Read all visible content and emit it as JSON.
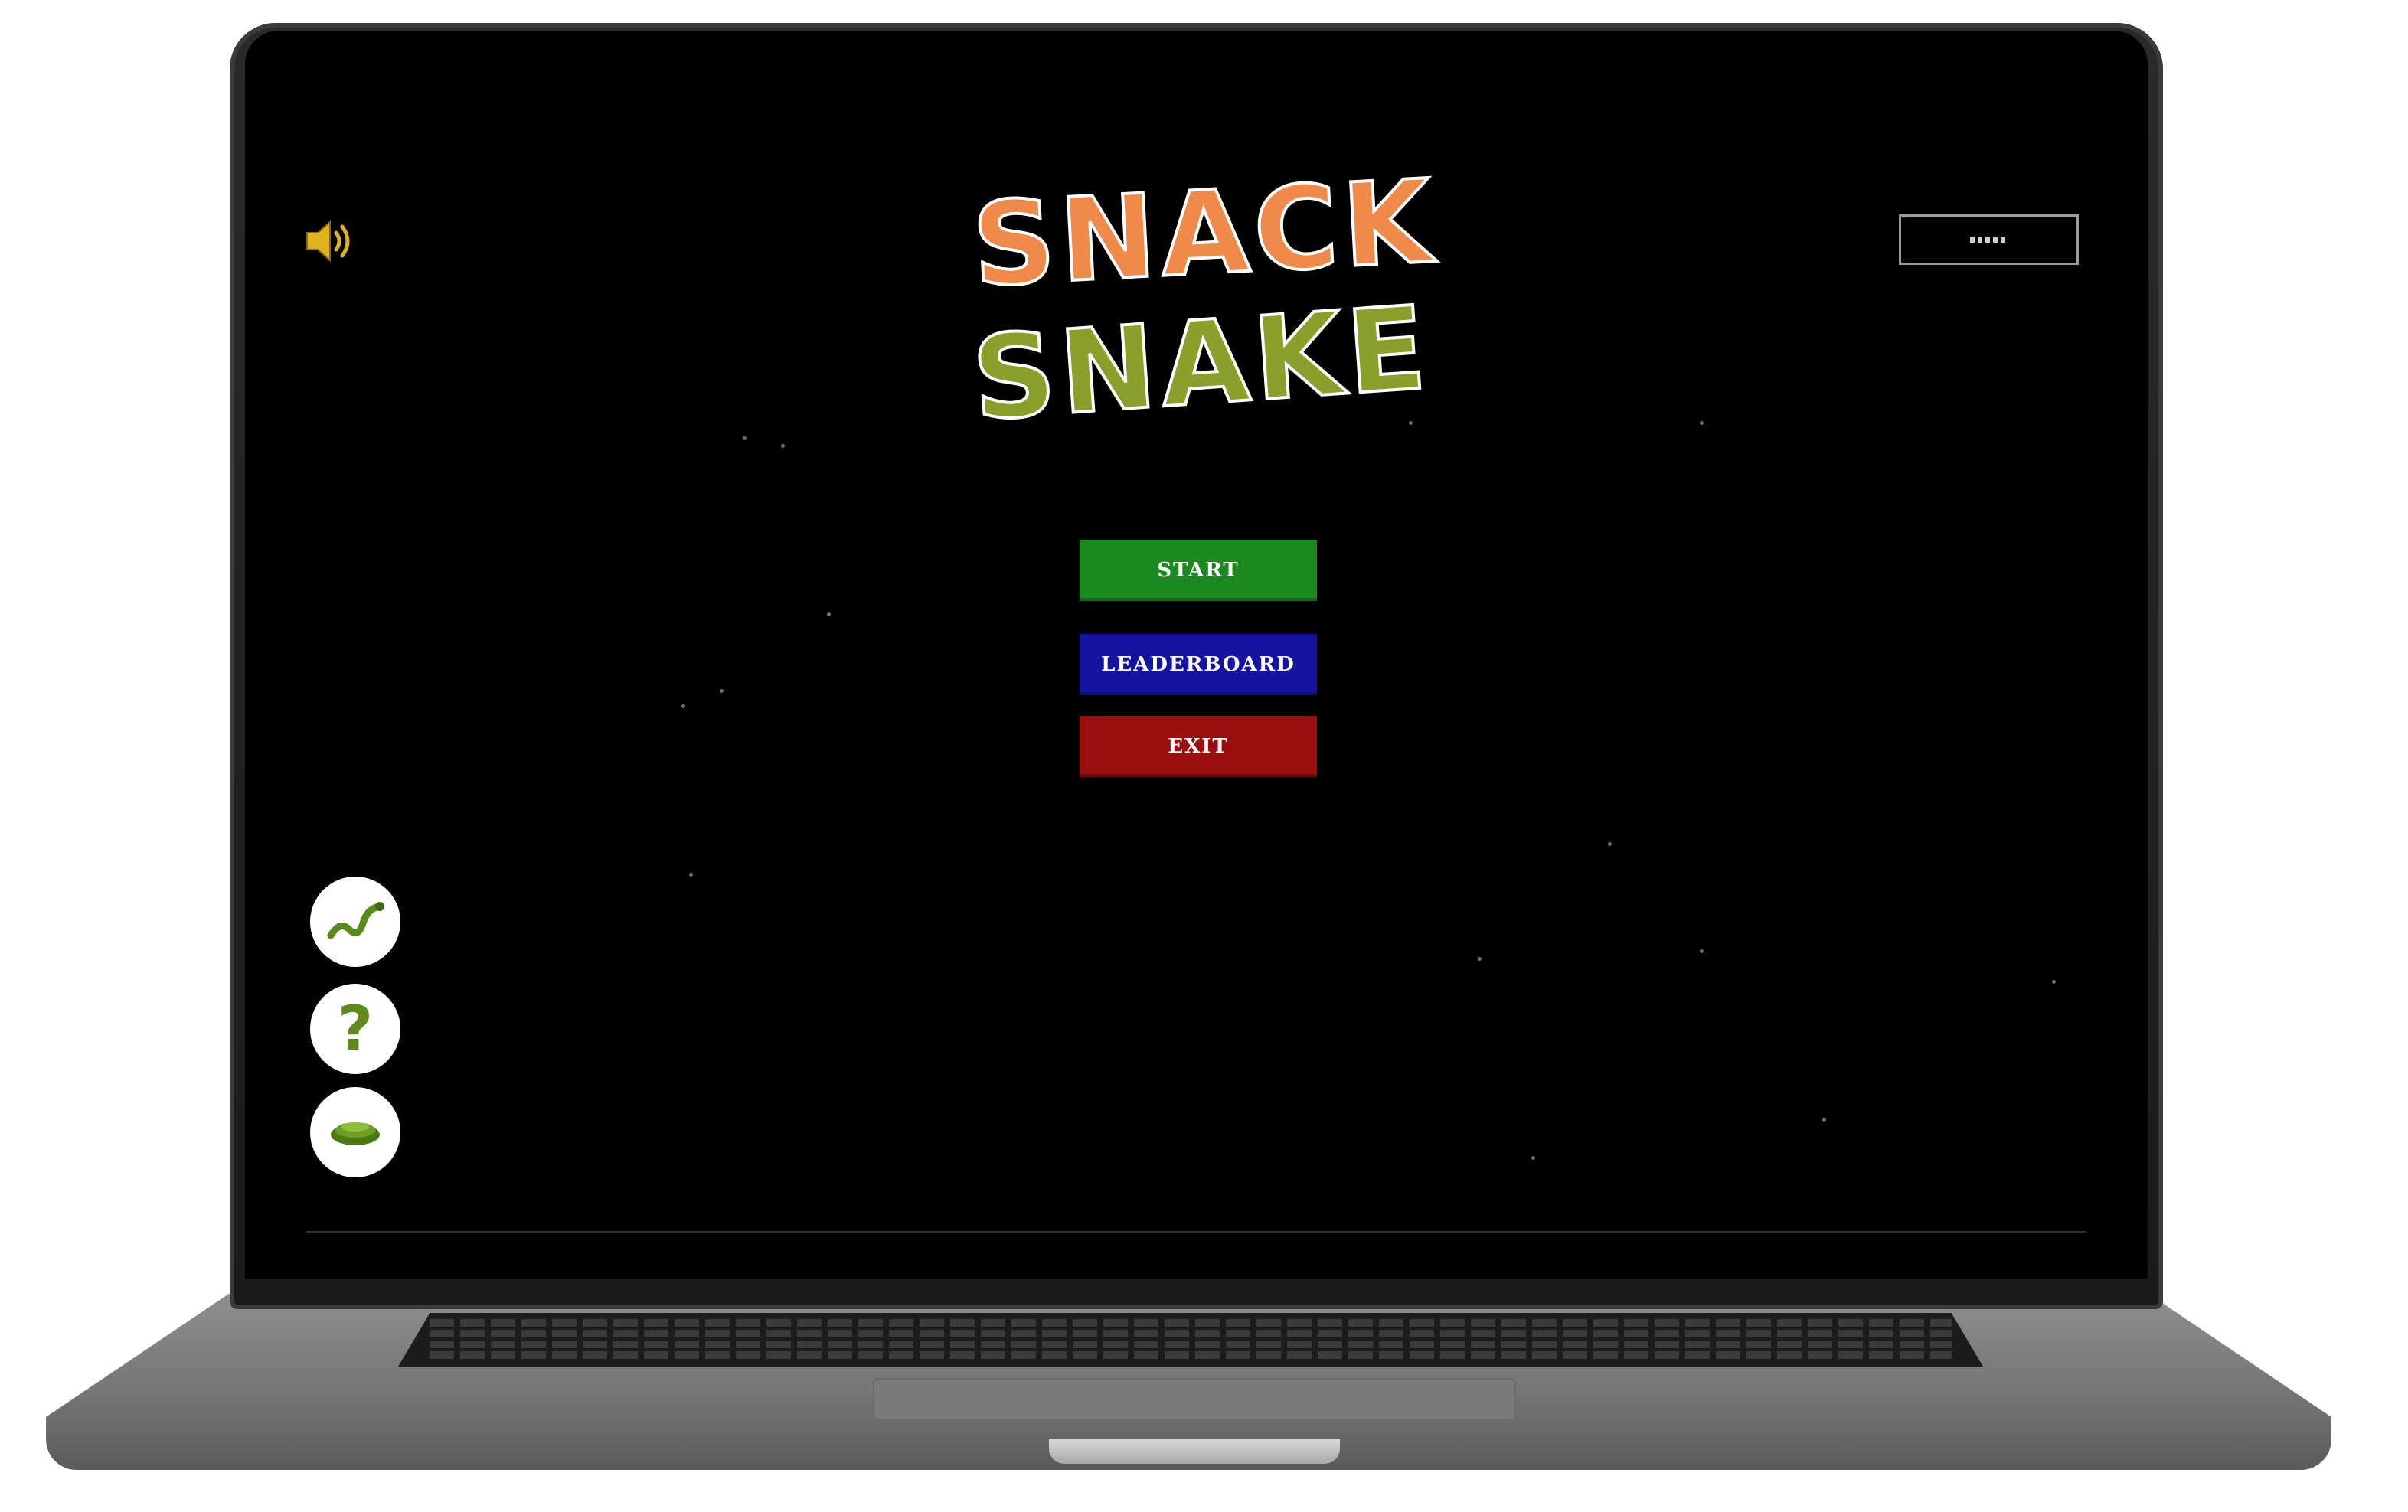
{
  "game": {
    "title_line1": "SNACK",
    "title_line2": "SNAKE"
  },
  "menu": {
    "start_label": "START",
    "leaderboard_label": "LEADERBOARD",
    "exit_label": "EXIT"
  },
  "colors": {
    "start_bg": "#1a8a1f",
    "leaderboard_bg": "#1414a0",
    "exit_bg": "#9a0e0e",
    "title_snack": "#f08a4b",
    "title_snake": "#8aa02a",
    "screen_bg": "#000000"
  },
  "icons": {
    "sound": "speaker-icon",
    "side_buttons": [
      "snake-icon",
      "question-icon",
      "snake-nest-icon"
    ]
  }
}
